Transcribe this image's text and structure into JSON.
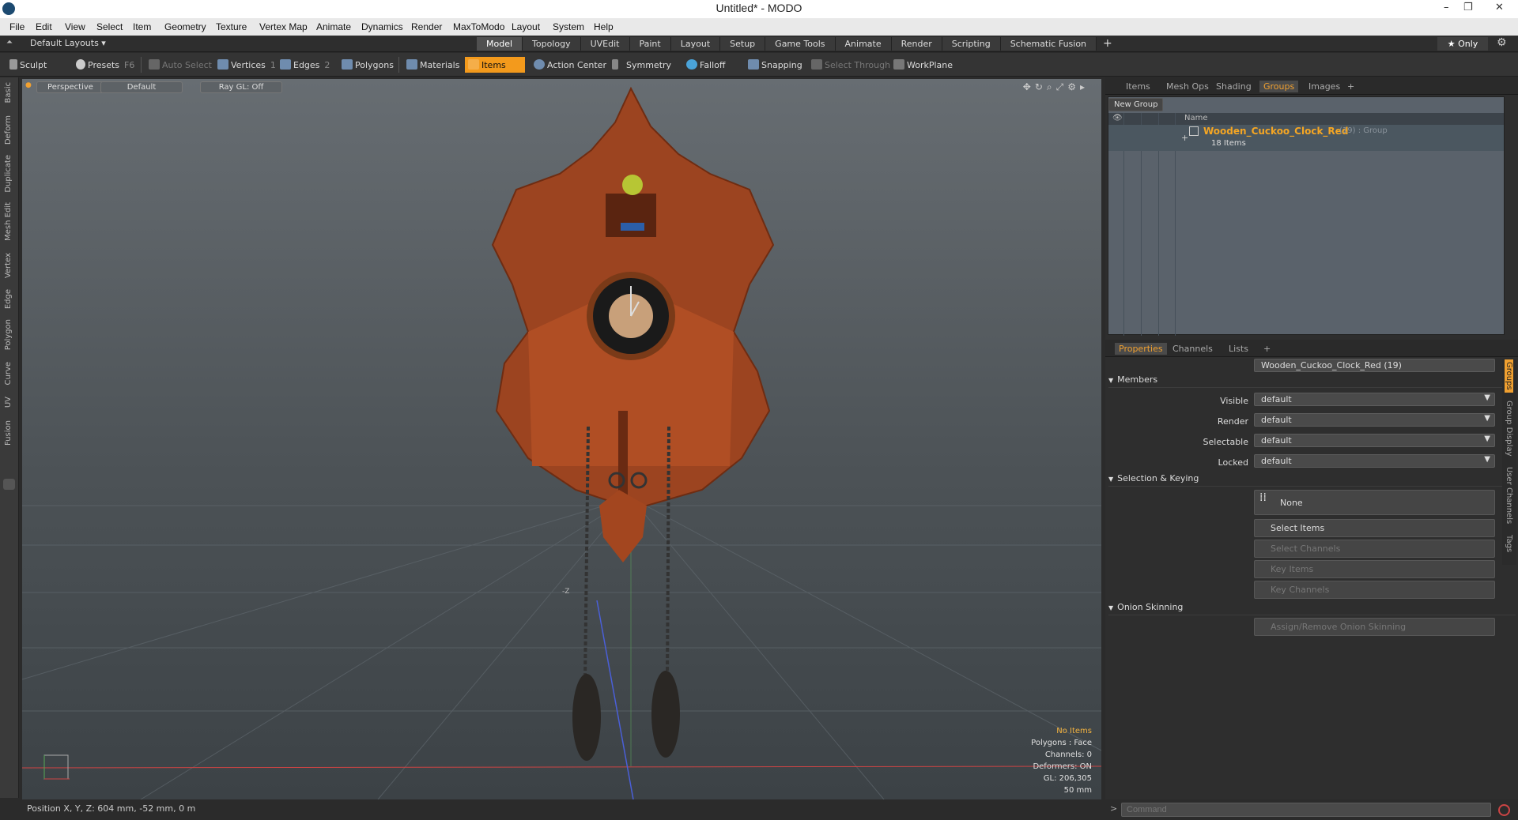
{
  "window": {
    "title": "Untitled* - MODO",
    "controls": [
      "–",
      "❐",
      "✕"
    ]
  },
  "menu": [
    "File",
    "Edit",
    "View",
    "Select",
    "Item",
    "Geometry",
    "Texture",
    "Vertex Map",
    "Animate",
    "Dynamics",
    "Render",
    "MaxToModo",
    "Layout",
    "System",
    "Help"
  ],
  "layout": {
    "selector": "Default Layouts ▾",
    "tabs": [
      "Model",
      "Topology",
      "UVEdit",
      "Paint",
      "Layout",
      "Setup",
      "Game Tools",
      "Animate",
      "Render",
      "Scripting",
      "Schematic Fusion"
    ],
    "active_tab": "Model",
    "plus": "+",
    "only": "★ Only"
  },
  "toolbar": {
    "sculpt": "Sculpt",
    "presets": "Presets",
    "presets_key": "F6",
    "auto_select": "Auto Select",
    "vertices": "Vertices",
    "vertices_key": "1",
    "edges": "Edges",
    "edges_key": "2",
    "polygons": "Polygons",
    "materials": "Materials",
    "items": "Items",
    "action_center": "Action Center",
    "symmetry": "Symmetry",
    "falloff": "Falloff",
    "snapping": "Snapping",
    "select_through": "Select Through",
    "workplane": "WorkPlane"
  },
  "left_tabs": [
    "Basic",
    "Deform",
    "Duplicate",
    "Mesh Edit",
    "Vertex",
    "Edge",
    "Polygon",
    "Curve",
    "UV",
    "Fusion"
  ],
  "viewport": {
    "view": "Perspective",
    "shading": "Default",
    "raygl": "Ray GL: Off",
    "stats": {
      "items": "No Items",
      "polygons": "Polygons : Face",
      "channels": "Channels: 0",
      "deformers": "Deformers: ON",
      "gl": "GL: 206,305",
      "scale": "50 mm"
    },
    "axis_label": "-Z"
  },
  "status": {
    "position": "Position X, Y, Z:  604 mm, -52 mm, 0 m"
  },
  "top_panel": {
    "tabs": [
      "Items",
      "Mesh Ops",
      "Shading",
      "Groups",
      "Images"
    ],
    "active": "Groups",
    "plus": "+",
    "new_group": "New Group",
    "col_name": "Name",
    "group": {
      "name": "Wooden_Cuckoo_Clock_Red",
      "count": "(19) : Group",
      "items": "18 Items"
    }
  },
  "properties": {
    "tabs": [
      "Properties",
      "Channels",
      "Lists"
    ],
    "active": "Properties",
    "plus": "+",
    "name_label": "Name",
    "name_value": "Wooden_Cuckoo_Clock_Red (19)",
    "members": "Members",
    "visible_label": "Visible",
    "visible": "default",
    "render_label": "Render",
    "render": "default",
    "selectable_label": "Selectable",
    "selectable": "default",
    "locked_label": "Locked",
    "locked": "default",
    "selection_keying": "Selection & Keying",
    "none": "None",
    "select_items": "Select Items",
    "select_channels": "Select Channels",
    "key_items": "Key Items",
    "key_channels": "Key Channels",
    "onion": "Onion Skinning",
    "onion_btn": "Assign/Remove Onion Skinning"
  },
  "side_tabs": [
    "Groups",
    "Group Display",
    "User Channels",
    "Tags"
  ],
  "command": {
    "placeholder": "Command"
  },
  "colors": {
    "accent": "#f39a1c",
    "wood": "#a0431e"
  }
}
